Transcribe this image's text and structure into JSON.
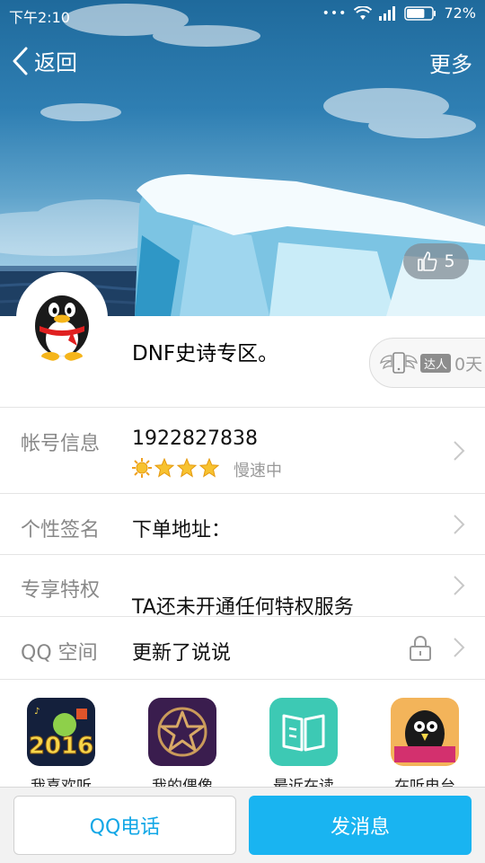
{
  "status_bar": {
    "time": "下午2:10",
    "battery": "72%",
    "battery_level": 0.72
  },
  "nav": {
    "back_label": "返回",
    "more_label": "更多"
  },
  "profile": {
    "likes": "5",
    "nickname": "DNF史诗专区。",
    "daren_tag": "达人",
    "daren_days": "0天"
  },
  "rows": {
    "account": {
      "label": "帐号信息",
      "value": "1922827838",
      "level_stars": 4,
      "speed_text": "慢速中"
    },
    "signature": {
      "label": "个性签名",
      "value": "下单地址："
    },
    "privilege": {
      "label": "专享特权",
      "value": "TA还未开通任何特权服务"
    },
    "qzone": {
      "label": "QQ 空间",
      "value": "更新了说说"
    }
  },
  "apps": [
    {
      "label": "我喜欢听",
      "icon": "music-2016-icon"
    },
    {
      "label": "我的偶像",
      "icon": "idol-star-icon"
    },
    {
      "label": "最近在读",
      "icon": "book-icon"
    },
    {
      "label": "在听电台",
      "icon": "radio-penguin-icon"
    }
  ],
  "bottom": {
    "call_label": "QQ电话",
    "message_label": "发消息"
  },
  "colors": {
    "accent": "#19b4f1",
    "call_text": "#12a7e6"
  }
}
